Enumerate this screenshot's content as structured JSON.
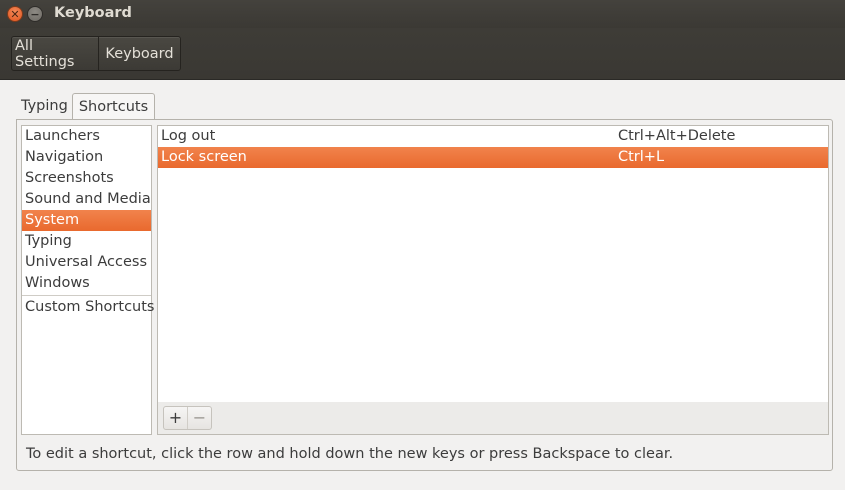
{
  "window": {
    "title": "Keyboard",
    "close_glyph": "✕",
    "minimize_glyph": "−"
  },
  "breadcrumb": [
    "All Settings",
    "Keyboard"
  ],
  "tabs": [
    {
      "label": "Typing",
      "active": false
    },
    {
      "label": "Shortcuts",
      "active": true
    }
  ],
  "categories": [
    {
      "label": "Launchers",
      "selected": false
    },
    {
      "label": "Navigation",
      "selected": false
    },
    {
      "label": "Screenshots",
      "selected": false
    },
    {
      "label": "Sound and Media",
      "selected": false
    },
    {
      "label": "System",
      "selected": true
    },
    {
      "label": "Typing",
      "selected": false
    },
    {
      "label": "Universal Access",
      "selected": false
    },
    {
      "label": "Windows",
      "selected": false
    },
    {
      "label": "Custom Shortcuts",
      "selected": false
    }
  ],
  "shortcuts": [
    {
      "action": "Log out",
      "accel": "Ctrl+Alt+Delete",
      "selected": false
    },
    {
      "action": "Lock screen",
      "accel": "Ctrl+L",
      "selected": true
    }
  ],
  "list_toolbar": {
    "add_glyph": "+",
    "remove_glyph": "−"
  },
  "hint": "To edit a shortcut, click the row and hold down the new keys or press Backspace to clear.",
  "colors": {
    "selection": "#e9692e",
    "titlebar": "#3c3b37",
    "close_button": "#e9692e"
  }
}
